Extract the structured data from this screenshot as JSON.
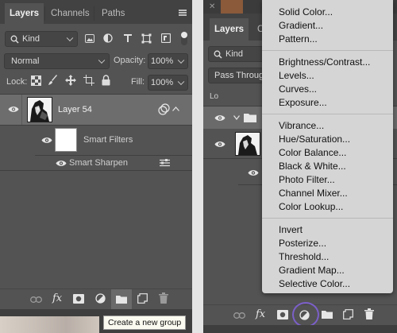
{
  "left_panel": {
    "tabs": [
      {
        "label": "Layers"
      },
      {
        "label": "Channels"
      },
      {
        "label": "Paths"
      }
    ],
    "filter": {
      "label": "Kind"
    },
    "blend_mode": {
      "value": "Normal"
    },
    "opacity": {
      "label": "Opacity:",
      "value": "100%"
    },
    "lock": {
      "label": "Lock:"
    },
    "fill": {
      "label": "Fill:",
      "value": "100%"
    },
    "layers": [
      {
        "name": "Layer 54"
      },
      {
        "name": "Smart Filters"
      },
      {
        "name": "Smart Sharpen"
      }
    ],
    "tooltip": "Create a new group"
  },
  "right_panel": {
    "tabs": [
      {
        "label": "Layers"
      },
      {
        "label": "Cl"
      }
    ],
    "filter": {
      "label": "Kind"
    },
    "blend_mode": {
      "value": "Pass Throug"
    }
  },
  "adjustment_menu": {
    "groups": [
      [
        "Solid Color...",
        "Gradient...",
        "Pattern..."
      ],
      [
        "Brightness/Contrast...",
        "Levels...",
        "Curves...",
        "Exposure..."
      ],
      [
        "Vibrance...",
        "Hue/Saturation...",
        "Color Balance...",
        "Black & White...",
        "Photo Filter...",
        "Channel Mixer...",
        "Color Lookup..."
      ],
      [
        "Invert",
        "Posterize...",
        "Threshold...",
        "Gradient Map...",
        "Selective Color..."
      ]
    ]
  },
  "colors": {
    "panel": "#535353",
    "tabbar": "#424242",
    "menu_bg": "#d5d5d5",
    "highlight_ring": "#7b5fc8"
  }
}
